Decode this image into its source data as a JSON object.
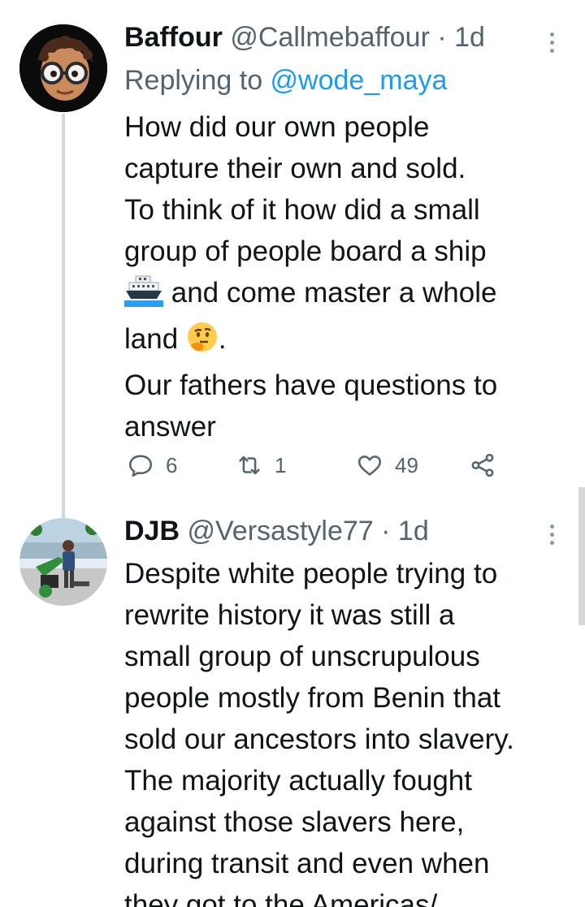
{
  "tweets": [
    {
      "name": "Baffour",
      "handle": "@Callmebaffour",
      "separator": "·",
      "time": "1d",
      "reply_prefix": "Replying to ",
      "reply_to": "@wode_maya",
      "text_a": "How did our own people\ncapture their own and sold.\nTo think of it how did a small\ngroup of people board a ship\n",
      "text_b": " and come master a whole\nland ",
      "text_c": ".\nOur fathers have questions to\nanswer",
      "emoji_1": "ship-emoji",
      "emoji_2": "thinking-face-emoji",
      "stats": {
        "replies": "6",
        "retweets": "1",
        "likes": "49"
      }
    },
    {
      "name": "DJB",
      "handle": "@Versastyle77",
      "separator": "·",
      "time": "1d",
      "text": "Despite white people trying to\nrewrite history it was still a\nsmall group of unscrupulous\npeople mostly from Benin that\nsold our ancestors into slavery.\nThe majority actually fought\nagainst those slavers here,\nduring transit and even when\nthey got to the Americas/"
    }
  ],
  "icons": {
    "reply": "reply-icon",
    "retweet": "retweet-icon",
    "like": "heart-icon",
    "share": "share-icon",
    "more": "more-vertical-icon"
  },
  "colors": {
    "link": "#1d9bf0",
    "secondary_text": "#536471",
    "thread_line": "#cfd9de"
  }
}
